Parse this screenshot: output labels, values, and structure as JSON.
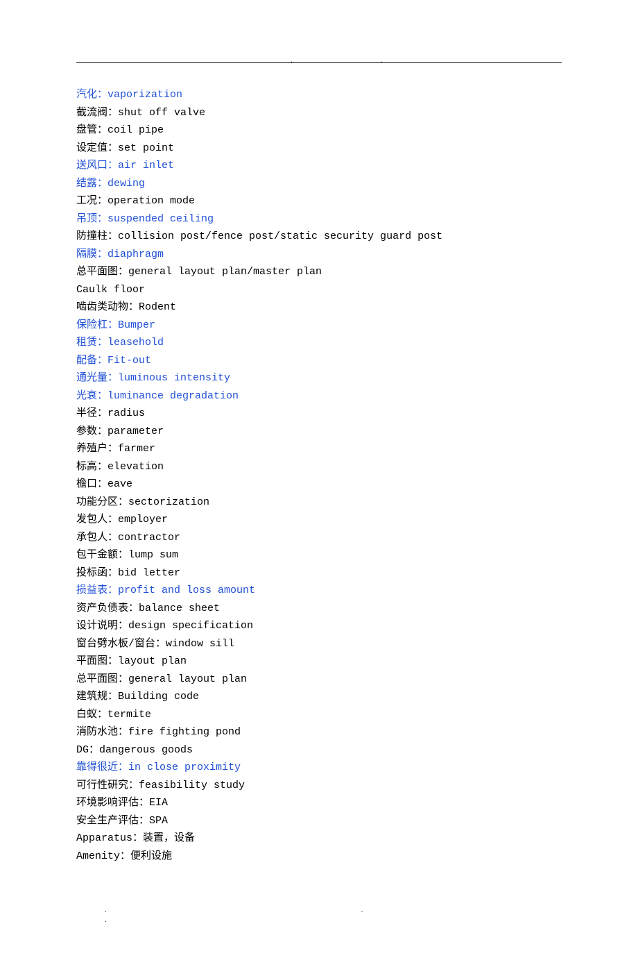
{
  "entries": [
    {
      "text": "汽化：vaporization",
      "color": "blue"
    },
    {
      "text": "截流阀：shut off valve",
      "color": "black"
    },
    {
      "text": "盘管：coil pipe",
      "color": "black"
    },
    {
      "text": "设定值：set point",
      "color": "black"
    },
    {
      "text": "送风口：air inlet",
      "color": "blue"
    },
    {
      "text": "结露：dewing",
      "color": "blue"
    },
    {
      "text": "工况：operation mode",
      "color": "black"
    },
    {
      "text": "吊顶：suspended ceiling",
      "color": "blue"
    },
    {
      "text": "防撞柱：collision post/fence post/static security guard post",
      "color": "black"
    },
    {
      "text": "隔膜：diaphragm",
      "color": "blue"
    },
    {
      "text": "总平面图：general layout plan/master plan",
      "color": "black"
    },
    {
      "text": "Caulk floor",
      "color": "black"
    },
    {
      "text": "啮齿类动物：Rodent",
      "color": "black"
    },
    {
      "text": "保险杠：Bumper",
      "color": "blue"
    },
    {
      "text": "租赁：leasehold",
      "color": "blue"
    },
    {
      "text": "配备：Fit-out",
      "color": "blue"
    },
    {
      "text": "通光量：luminous intensity",
      "color": "blue"
    },
    {
      "text": "光衰：luminance degradation",
      "color": "blue"
    },
    {
      "text": "半径：radius",
      "color": "black"
    },
    {
      "text": "参数：parameter",
      "color": "black"
    },
    {
      "text": "养殖户：farmer",
      "color": "black"
    },
    {
      "text": "标高：elevation",
      "color": "black"
    },
    {
      "text": "檐口：eave",
      "color": "black"
    },
    {
      "text": "功能分区：sectorization",
      "color": "black"
    },
    {
      "text": "发包人：employer",
      "color": "black"
    },
    {
      "text": "承包人：contractor",
      "color": "black"
    },
    {
      "text": "包干金额：lump sum",
      "color": "black"
    },
    {
      "text": "投标函：bid letter",
      "color": "black"
    },
    {
      "text": "损益表：profit and loss amount",
      "color": "blue"
    },
    {
      "text": "资产负债表：balance sheet",
      "color": "black"
    },
    {
      "text": "设计说明：design specification",
      "color": "black"
    },
    {
      "text": "窗台劈水板/窗台：window sill",
      "color": "black"
    },
    {
      "text": "平面图：layout plan",
      "color": "black"
    },
    {
      "text": "总平面图：general layout plan",
      "color": "black"
    },
    {
      "text": "建筑规：Building code",
      "color": "black"
    },
    {
      "text": "白蚁：termite",
      "color": "black"
    },
    {
      "text": "消防水池：fire fighting pond",
      "color": "black"
    },
    {
      "text": "DG：dangerous goods",
      "color": "black"
    },
    {
      "text": "靠得很近：in close proximity",
      "color": "blue"
    },
    {
      "text": "可行性研究：feasibility study",
      "color": "black"
    },
    {
      "text": "环境影响评估：EIA",
      "color": "black"
    },
    {
      "text": "安全生产评估：SPA",
      "color": "black"
    },
    {
      "text": "Apparatus：装置，设备",
      "color": "black"
    },
    {
      "text": "Amenity：便利设施",
      "color": "black"
    }
  ],
  "header_marks": ". .",
  "footer_marks": ". . ."
}
